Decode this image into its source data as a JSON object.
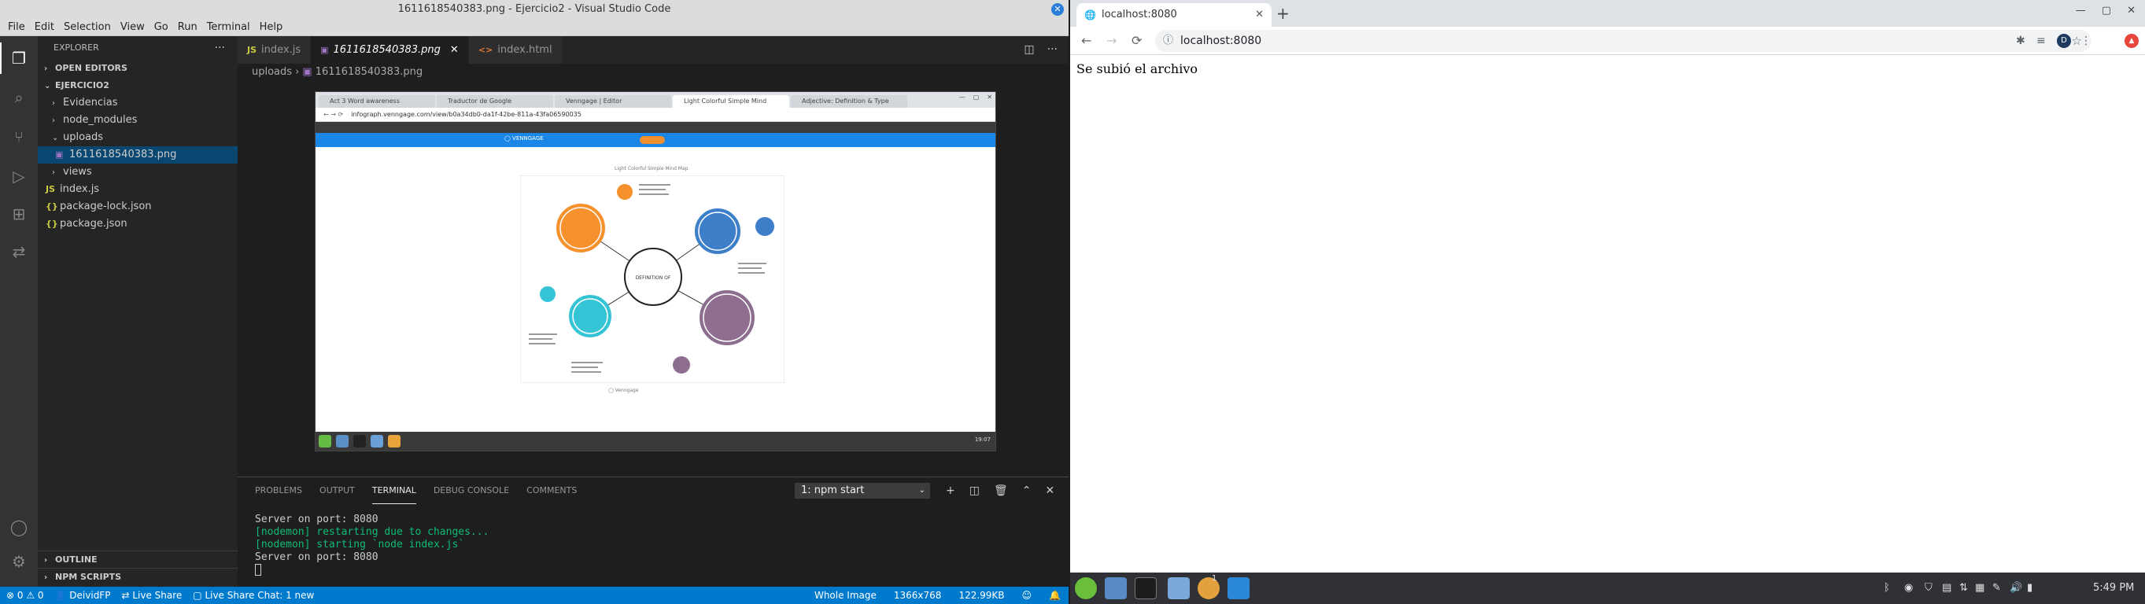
{
  "vscode": {
    "window_title": "1611618540383.png - Ejercicio2 - Visual Studio Code",
    "menu": [
      "File",
      "Edit",
      "Selection",
      "View",
      "Go",
      "Run",
      "Terminal",
      "Help"
    ],
    "explorer_title": "EXPLORER",
    "open_editors": "OPEN EDITORS",
    "project": "EJERCICIO2",
    "tree": [
      {
        "label": "Evidencias",
        "type": "folder"
      },
      {
        "label": "node_modules",
        "type": "folder"
      },
      {
        "label": "uploads",
        "type": "folder-open"
      },
      {
        "label": "1611618540383.png",
        "type": "image",
        "selected": true
      },
      {
        "label": "views",
        "type": "folder"
      },
      {
        "label": "index.js",
        "type": "js"
      },
      {
        "label": "package-lock.json",
        "type": "json"
      },
      {
        "label": "package.json",
        "type": "json"
      }
    ],
    "outline": "OUTLINE",
    "npm_scripts": "NPM SCRIPTS",
    "tabs": [
      {
        "label": "index.js",
        "icon": "JS",
        "active": false
      },
      {
        "label": "1611618540383.png",
        "icon": "▣",
        "active": true
      },
      {
        "label": "index.html",
        "icon": "<>",
        "active": false
      }
    ],
    "breadcrumb": [
      "uploads",
      "1611618540383.png"
    ],
    "image_preview": {
      "browser_tabs": [
        "Act 3 Word awareness",
        "Traductor de Google",
        "Venngage | Editor",
        "Light Colorful Simple Mind",
        "Adjective: Definition & Type"
      ],
      "url": "infograph.venngage.com/view/b0a34db0-da1f-42be-811a-43fa06590035",
      "page_title": "Light Colorful Simple Mind Map",
      "center_label": "DEFINITION OF",
      "footer": "Venngage",
      "time": "19:07"
    },
    "panel_tabs": [
      "PROBLEMS",
      "OUTPUT",
      "TERMINAL",
      "DEBUG CONSOLE",
      "COMMENTS"
    ],
    "terminal_select": "1: npm start",
    "terminal_lines": [
      {
        "text": "Server on port: 8080",
        "color": "white"
      },
      {
        "text": "[nodemon] restarting due to changes...",
        "color": "green"
      },
      {
        "text": "[nodemon] starting `node index.js`",
        "color": "green"
      },
      {
        "text": "Server on port: 8080",
        "color": "white"
      }
    ],
    "status_left": [
      "⊗ 0 ⚠ 0",
      "DeividFP",
      "Live Share",
      "Live Share Chat: 1 new"
    ],
    "status_right": [
      "Whole Image",
      "1366x768",
      "122.99KB"
    ]
  },
  "chrome": {
    "tab_title": "localhost:8080",
    "url": "localhost:8080",
    "avatar": "D",
    "content": "Se subió el archivo"
  },
  "taskbar": {
    "time": "5:49 PM",
    "badge": "1"
  },
  "colors": {
    "vscode_accent": "#007acc",
    "selection": "#094771",
    "terminal_green": "#0dbc79",
    "venngage_blue": "#1a86e8"
  }
}
